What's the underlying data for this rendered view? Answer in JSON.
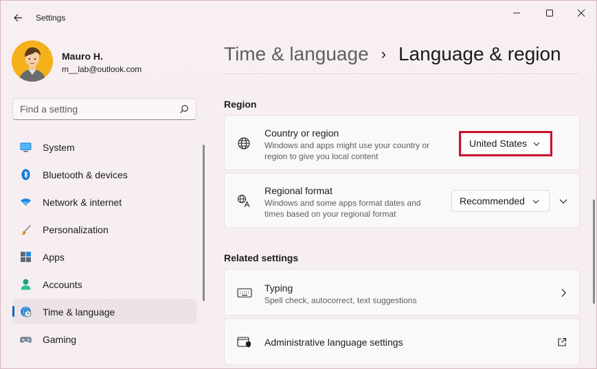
{
  "window": {
    "title": "Settings"
  },
  "profile": {
    "name": "Mauro H.",
    "email": "m__lab@outlook.com"
  },
  "search": {
    "placeholder": "Find a setting"
  },
  "sidebar": {
    "items": [
      {
        "label": "System",
        "icon": "monitor-icon"
      },
      {
        "label": "Bluetooth & devices",
        "icon": "bluetooth-icon"
      },
      {
        "label": "Network & internet",
        "icon": "wifi-icon"
      },
      {
        "label": "Personalization",
        "icon": "brush-icon"
      },
      {
        "label": "Apps",
        "icon": "apps-icon"
      },
      {
        "label": "Accounts",
        "icon": "person-icon"
      },
      {
        "label": "Time & language",
        "icon": "globe-clock-icon",
        "active": true
      },
      {
        "label": "Gaming",
        "icon": "gamepad-icon"
      }
    ]
  },
  "header": {
    "parent": "Time & language",
    "separator": "›",
    "current": "Language & region"
  },
  "region": {
    "title": "Region",
    "country": {
      "title": "Country or region",
      "description": "Windows and apps might use your country or region to give you local content",
      "value": "United States"
    },
    "format": {
      "title": "Regional format",
      "description": "Windows and some apps format dates and times based on your regional format",
      "value": "Recommended"
    }
  },
  "related": {
    "title": "Related settings",
    "typing": {
      "title": "Typing",
      "description": "Spell check, autocorrect, text suggestions"
    },
    "admin": {
      "title": "Administrative language settings"
    }
  },
  "colors": {
    "accent": "#0067c0",
    "highlight": "#c8102e"
  }
}
